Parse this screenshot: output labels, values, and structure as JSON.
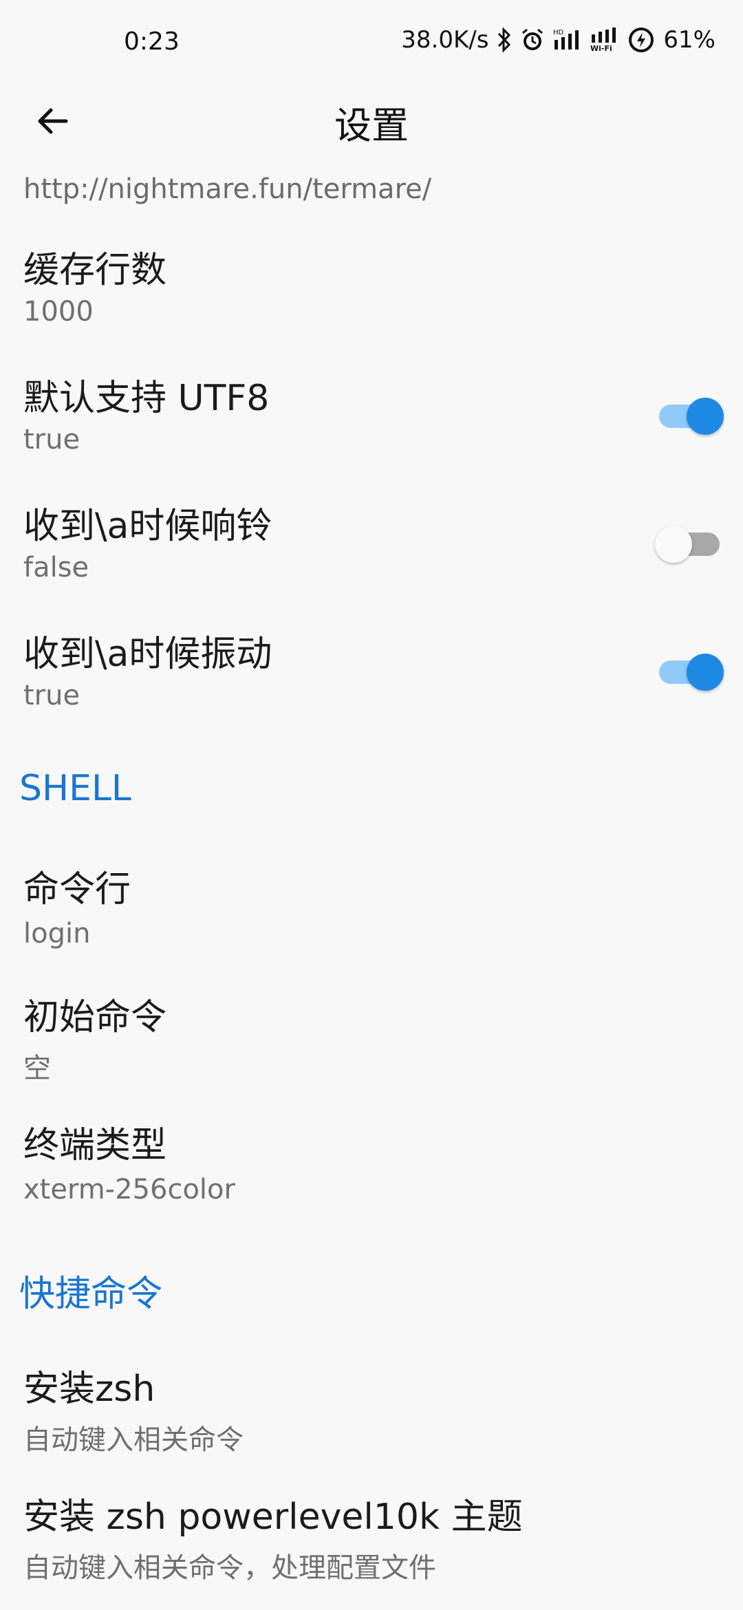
{
  "status_bar": {
    "time": "0:23",
    "net_speed": "38.0K/s",
    "battery": "61%",
    "icons": [
      "bluetooth-icon",
      "alarm-icon",
      "signal-icon",
      "wifi-icon",
      "battery-charging-icon"
    ]
  },
  "app_bar": {
    "title": "设置",
    "back_icon": "arrow-back-icon"
  },
  "url": "http://nightmare.fun/termare/",
  "items": [
    {
      "title": "缓存行数",
      "subtitle": "1000"
    },
    {
      "title": "默认支持 UTF8",
      "subtitle": "true",
      "switch": true
    },
    {
      "title": "收到\\a时候响铃",
      "subtitle": "false",
      "switch": false
    },
    {
      "title": "收到\\a时候振动",
      "subtitle": "true",
      "switch": true
    }
  ],
  "sections": {
    "shell": {
      "header": "SHELL",
      "items": [
        {
          "title": "命令行",
          "subtitle": "login"
        },
        {
          "title": "初始命令",
          "subtitle": "空"
        },
        {
          "title": "终端类型",
          "subtitle": "xterm-256color"
        }
      ]
    },
    "quick": {
      "header": "快捷命令",
      "items": [
        {
          "title": "安装zsh",
          "subtitle": "自动键入相关命令"
        },
        {
          "title": "安装 zsh powerlevel10k 主题",
          "subtitle": "自动键入相关命令，处理配置文件"
        }
      ]
    }
  },
  "colors": {
    "accent": "#1976d2",
    "switch_on": "#1e88e5",
    "switch_on_track": "#90caf9",
    "switch_off_track": "#a8a8a8",
    "background": "#f8f8f9"
  }
}
